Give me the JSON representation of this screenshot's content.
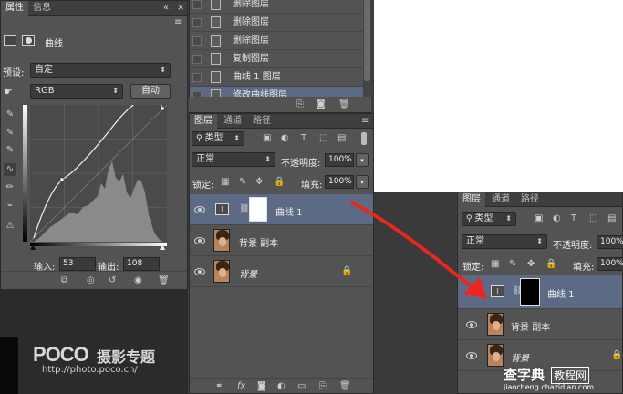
{
  "properties": {
    "tabs": [
      "属性",
      "信息"
    ],
    "title": "曲线",
    "preset_label": "预设:",
    "preset_value": "自定",
    "channel_value": "RGB",
    "auto_label": "自动",
    "input_label": "输入:",
    "input_value": "53",
    "output_label": "输出:",
    "output_value": "108"
  },
  "history": {
    "items": [
      {
        "label": "删除图层",
        "selected": false
      },
      {
        "label": "删除图层",
        "selected": false
      },
      {
        "label": "删除图层",
        "selected": false
      },
      {
        "label": "复制图层",
        "selected": false
      },
      {
        "label": "曲线 1 图层",
        "selected": false
      },
      {
        "label": "修改曲线图层",
        "selected": true
      }
    ]
  },
  "layers_main": {
    "tabs": [
      "图层",
      "通道",
      "路径"
    ],
    "filter_label": "类型",
    "blend_mode": "正常",
    "opacity_label": "不透明度:",
    "opacity_value": "100%",
    "lock_label": "锁定:",
    "fill_label": "填充:",
    "fill_value": "100%",
    "layers": [
      {
        "name": "曲线 1",
        "type": "adjustment",
        "selected": true
      },
      {
        "name": "背景 副本",
        "type": "photo",
        "selected": false
      },
      {
        "name": "背景",
        "type": "photo",
        "selected": false,
        "locked": true
      }
    ]
  },
  "layers_right": {
    "tabs": [
      "图层",
      "通道",
      "路径"
    ],
    "filter_label": "类型",
    "blend_mode": "正常",
    "opacity_label": "不透明度:",
    "opacity_value": "100%",
    "lock_label": "锁定:",
    "fill_label": "填充:",
    "fill_value": "100%",
    "layers": [
      {
        "name": "曲线 1",
        "type": "adjustment",
        "selected": true
      },
      {
        "name": "背景 副本",
        "type": "photo",
        "selected": false
      },
      {
        "name": "背景",
        "type": "photo",
        "selected": false,
        "locked": true
      }
    ]
  },
  "watermark": {
    "brand": "POCO",
    "brand_cn": "摄影专题",
    "url": "http://photo.poco.cn/",
    "site": "查字典",
    "site2": "教程网",
    "site_url": "jiaocheng.chazidian.com"
  },
  "colors": {
    "accent_red": "#e8271f",
    "selection": "#5d6a86"
  }
}
